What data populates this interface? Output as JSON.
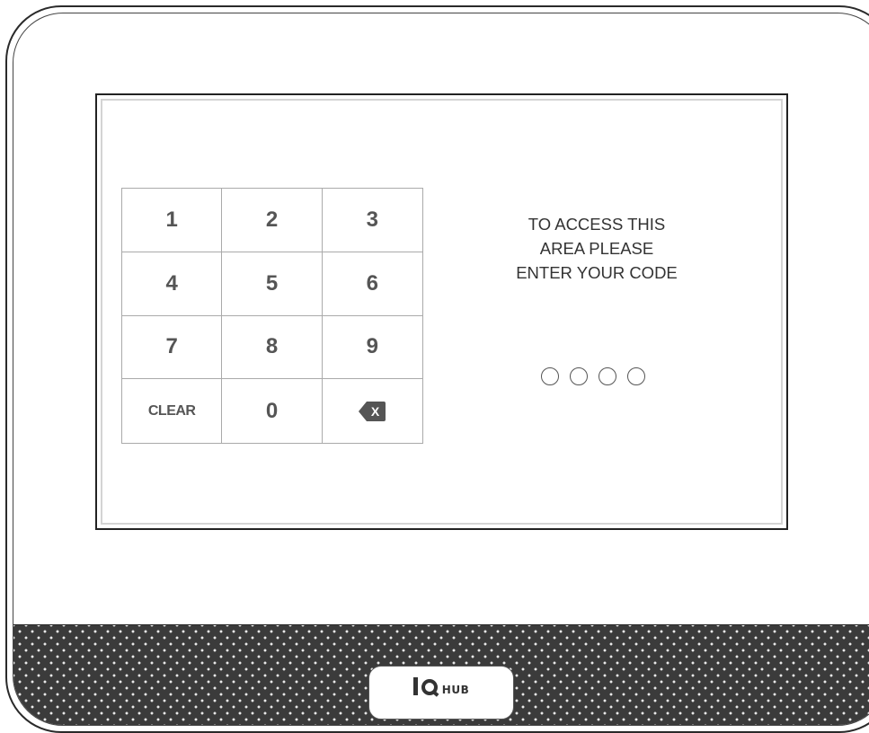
{
  "keypad": {
    "keys": [
      "1",
      "2",
      "3",
      "4",
      "5",
      "6",
      "7",
      "8",
      "9",
      "CLEAR",
      "0",
      "X"
    ]
  },
  "prompt": {
    "line1": "TO ACCESS THIS",
    "line2": "AREA PLEASE",
    "line3": "ENTER YOUR CODE"
  },
  "code_entry": {
    "digits_total": 4,
    "digits_entered": 0
  },
  "branding": {
    "logo_text": "HUB"
  },
  "colors": {
    "grille": "#3b3b3b",
    "key_text": "#555555"
  }
}
